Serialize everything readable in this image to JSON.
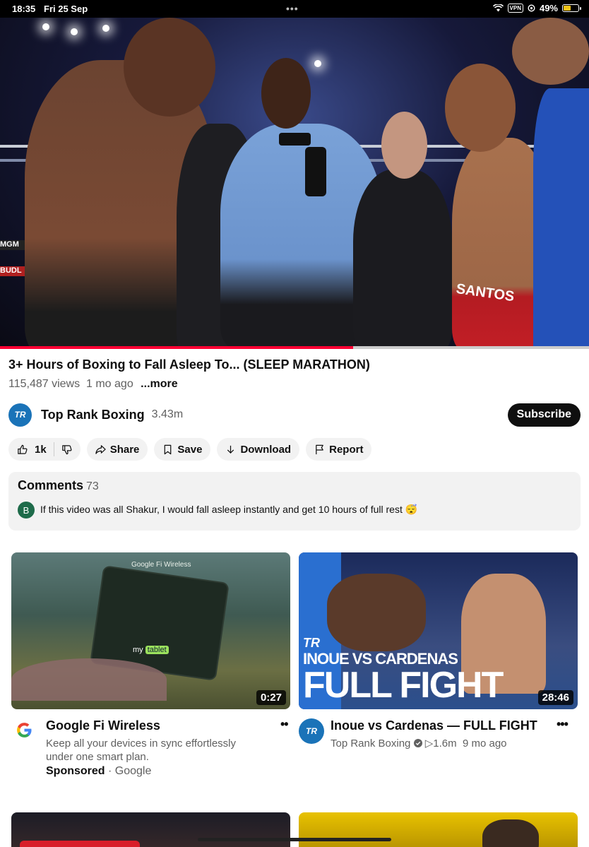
{
  "status_bar": {
    "time": "18:35",
    "date": "Fri 25 Sep",
    "dots": "•••",
    "vpn": "VPN",
    "battery_pct": "49%",
    "battery_level": 0.49
  },
  "player": {
    "progress": 0.6
  },
  "video": {
    "title": "3+ Hours of Boxing to Fall Asleep To... (SLEEP MARATHON)",
    "views": "115,487 views",
    "age": "1 mo ago",
    "more": "...more"
  },
  "channel": {
    "avatar_text": "TR",
    "name": "Top Rank Boxing",
    "subs": "3.43m",
    "subscribe_label": "Subscribe"
  },
  "actions": {
    "likes": "1k",
    "share": "Share",
    "save": "Save",
    "download": "Download",
    "report": "Report"
  },
  "comments": {
    "heading": "Comments",
    "count": "73",
    "top_avatar": "B",
    "top_text": "If this video was all Shakur, I would fall asleep instantly and get 10 hours of full rest 😴"
  },
  "recommended": [
    {
      "thumb_brand": "Google Fi Wireless",
      "thumb_label_my": "my",
      "thumb_label_tablet": "tablet",
      "duration": "0:27",
      "title": "Google Fi Wireless",
      "description": "Keep all your devices in sync effortlessly under one smart plan.",
      "sponsored": "Sponsored",
      "advertiser": "· Google"
    },
    {
      "thumb_logo": "TR",
      "thumb_line1": "INOUE VS CARDENAS",
      "thumb_line2": "FULL FIGHT",
      "duration": "28:46",
      "channel_avatar": "TR",
      "title": "Inoue vs Cardenas — FULL FIGHT",
      "channel": "Top Rank Boxing",
      "views": "▷1.6m",
      "age": "9 mo ago"
    }
  ],
  "colors": {
    "accent_red": "#ff0033",
    "channel_blue": "#1a73b8"
  }
}
